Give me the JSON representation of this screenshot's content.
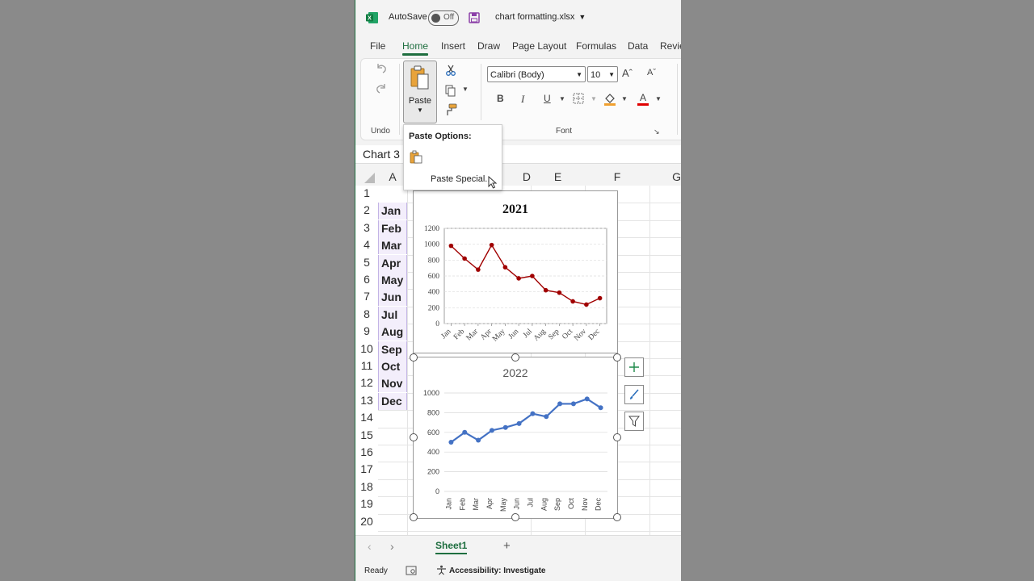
{
  "titlebar": {
    "autosave_label": "AutoSave",
    "autosave_state": "Off",
    "filename": "chart formatting.xlsx"
  },
  "tabs": [
    "File",
    "Home",
    "Insert",
    "Draw",
    "Page Layout",
    "Formulas",
    "Data",
    "Revie"
  ],
  "ribbon": {
    "undo_group": "Undo",
    "paste_label": "Paste",
    "font_name": "Calibri (Body)",
    "font_size": "10",
    "font_group": "Font",
    "bold": "B",
    "italic": "I",
    "underline": "U"
  },
  "paste_popup": {
    "title": "Paste Options:",
    "special": "Paste Special..."
  },
  "namebox": "Chart 3",
  "columns": [
    "A",
    "D",
    "E",
    "F",
    "G"
  ],
  "rows": [
    "1",
    "2",
    "3",
    "4",
    "5",
    "6",
    "7",
    "8",
    "9",
    "10",
    "11",
    "12",
    "13",
    "14",
    "15",
    "16",
    "17",
    "18",
    "19",
    "20"
  ],
  "months": [
    "Jan",
    "Feb",
    "Mar",
    "Apr",
    "May",
    "Jun",
    "Jul",
    "Aug",
    "Sep",
    "Oct",
    "Nov",
    "Dec"
  ],
  "colors": {
    "accent": "#1e6e3f",
    "series2021": "#a00000",
    "series2022": "#4472c4"
  },
  "chart_data": [
    {
      "type": "line",
      "title": "2021",
      "categories": [
        "Jan",
        "Feb",
        "Mar",
        "Apr",
        "May",
        "Jun",
        "Jul",
        "Aug",
        "Sep",
        "Oct",
        "Nov",
        "Dec"
      ],
      "values": [
        980,
        820,
        680,
        990,
        710,
        570,
        600,
        420,
        390,
        280,
        240,
        320
      ],
      "ylim": [
        0,
        1200
      ],
      "yticks": [
        0,
        200,
        400,
        600,
        800,
        1000,
        1200
      ],
      "grid": true
    },
    {
      "type": "line",
      "title": "2022",
      "categories": [
        "Jan",
        "Feb",
        "Mar",
        "Apr",
        "May",
        "Jun",
        "Jul",
        "Aug",
        "Sep",
        "Oct",
        "Nov",
        "Dec"
      ],
      "values": [
        500,
        600,
        520,
        620,
        650,
        690,
        790,
        760,
        890,
        890,
        940,
        850
      ],
      "ylim": [
        0,
        1000
      ],
      "yticks": [
        0,
        200,
        400,
        600,
        800,
        1000
      ],
      "grid": true
    }
  ],
  "sheets": [
    "Sheet1"
  ],
  "status": {
    "ready": "Ready",
    "accessibility": "Accessibility: Investigate"
  }
}
